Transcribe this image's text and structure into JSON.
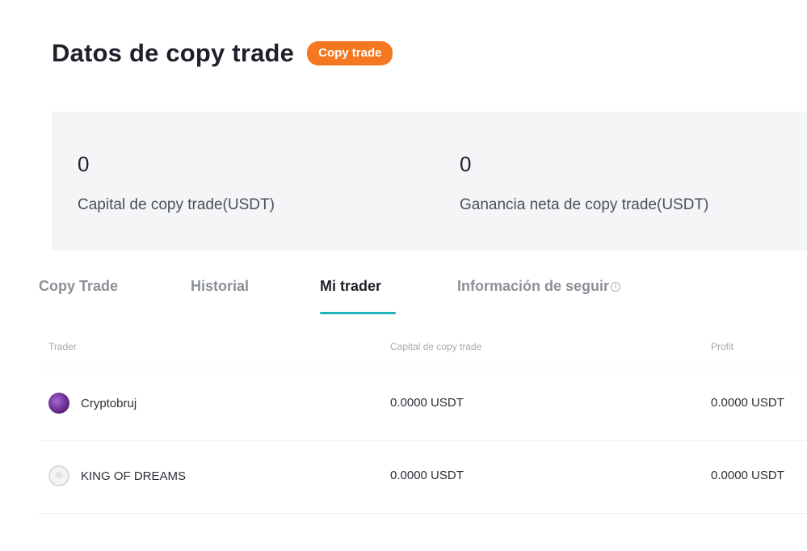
{
  "header": {
    "title": "Datos de copy trade",
    "badge": "Copy trade"
  },
  "summary": {
    "capital_value": "0",
    "capital_label": "Capital de copy trade(USDT)",
    "ganancia_value": "0",
    "ganancia_label": "Ganancia neta de copy trade(USDT)"
  },
  "tabs": {
    "copy_trade": "Copy Trade",
    "historial": "Historial",
    "mi_trader": "Mi trader",
    "informacion": "Información de seguir",
    "active": "Mi trader"
  },
  "table": {
    "columns": [
      "Trader",
      "Capital de copy trade",
      "Profit"
    ],
    "rows": [
      {
        "trader": "Cryptobruj",
        "avatar": "purple-avatar",
        "capital": "0.0000 USDT",
        "profit": "0.0000 USDT"
      },
      {
        "trader": "KING OF DREAMS",
        "avatar": "default-avatar",
        "capital": "0.0000 USDT",
        "profit": "0.0000 USDT"
      }
    ]
  },
  "colors": {
    "badge": "#f3781f",
    "tab_underline": "#1fb5b8",
    "summary_bg": "#f4f5f7"
  }
}
